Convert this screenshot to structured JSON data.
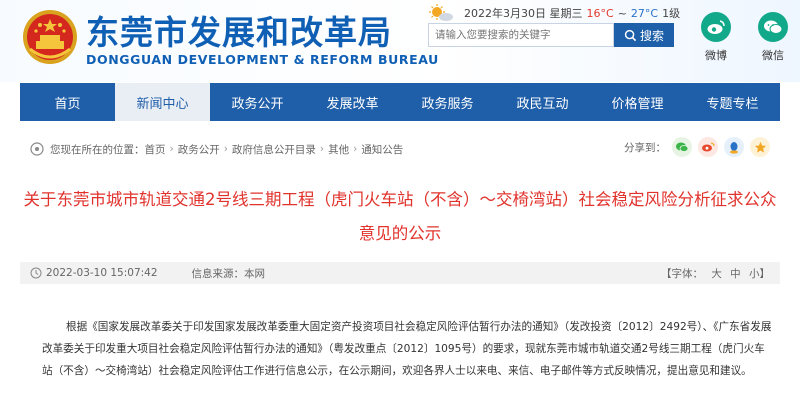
{
  "header": {
    "site_title": "东莞市发展和改革局",
    "site_subtitle": "DONGGUAN DEVELOPMENT & REFORM BUREAU",
    "weather": {
      "date": "2022年3月30日 星期三",
      "temp_low": "16°C",
      "temp_high": "27°C",
      "wind": "1级",
      "temp_sep": "~"
    },
    "search": {
      "placeholder": "请输入您要搜索的关键字",
      "button_label": "搜索"
    },
    "social": [
      {
        "label": "微博"
      },
      {
        "label": "微信"
      }
    ]
  },
  "nav": {
    "items": [
      {
        "label": "首页"
      },
      {
        "label": "新闻中心"
      },
      {
        "label": "政务公开"
      },
      {
        "label": "发展改革"
      },
      {
        "label": "政务服务"
      },
      {
        "label": "政民互动"
      },
      {
        "label": "价格管理"
      },
      {
        "label": "专题专栏"
      }
    ]
  },
  "breadcrumb": {
    "prefix": "您现在所在的位置：",
    "items": [
      "首页",
      "政务公开",
      "政府信息公开目录",
      "其他",
      "通知公告"
    ],
    "separator": "›",
    "share_label": "分享到："
  },
  "article": {
    "title": "关于东莞市城市轨道交通2号线三期工程（虎门火车站（不含）～交椅湾站）社会稳定风险分析征求公众意见的公示",
    "date": "2022-03-10 15:07:42",
    "source": "信息来源：本网",
    "font_label": "【字体：",
    "font_large": "大",
    "font_medium": "中",
    "font_small": "小】",
    "body": "根据《国家发展改革委关于印发国家发展改革委重大固定资产投资项目社会稳定风险评估暂行办法的通知》（发改投资〔2012〕2492号）、《广东省发展改革委关于印发重大项目社会稳定风险评估暂行办法的通知》（粤发改重点〔2012〕1095号）的要求，现就东莞市城市轨道交通2号线三期工程（虎门火车站（不含）～交椅湾站）社会稳定风险评估工作进行信息公示，在公示期间，欢迎各界人士以来电、来信、电子邮件等方式反映情况，提出意见和建议。"
  },
  "colors": {
    "brand_blue": "#1f5ea8",
    "title_red": "#e1322c",
    "social_green": "#12a88a"
  },
  "icons": {
    "emblem": "national-emblem-icon",
    "weather": "sun-cloud-icon",
    "search": "search-icon",
    "weibo": "weibo-icon",
    "wechat": "wechat-icon",
    "location": "location-icon",
    "clock": "clock-icon"
  }
}
